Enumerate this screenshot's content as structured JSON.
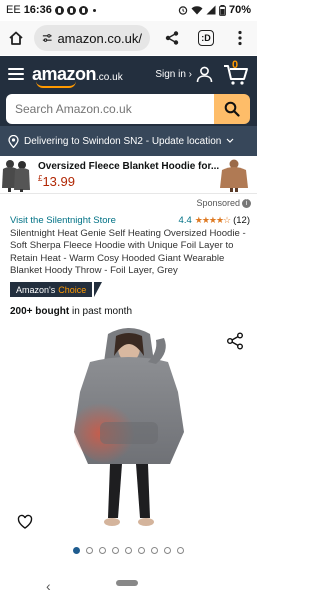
{
  "status_bar": {
    "carrier": "EE",
    "time": "16:36",
    "battery": "70%"
  },
  "browser": {
    "url": "amazon.co.uk/",
    "tab_count": ":D"
  },
  "header": {
    "logo": "amazon",
    "logo_tld": ".co.uk",
    "sign_in": "Sign in ›",
    "cart_count": "0",
    "search_placeholder": "Search Amazon.co.uk",
    "delivery_text": "Delivering to Swindon SN2 - Update location"
  },
  "sponsored_banner": {
    "title": "Oversized Fleece Blanket Hoodie for...",
    "price_symbol": "£",
    "price": "13.99"
  },
  "product": {
    "sponsored_label": "Sponsored",
    "store_link": "Visit the Silentnight Store",
    "rating_value": "4.4",
    "rating_count": "(12)",
    "title": "Silentnight Heat Genie Self Heating Oversized Hoodie - Soft Sherpa Fleece Hoodie with Unique Foil Layer to Retain Heat - Warm Cosy Hooded Giant Wearable Blanket Hoody Throw - Foil Layer, Grey",
    "badge_prefix": "Amazon's",
    "badge_choice": "Choice",
    "bought_bold": "200+ bought",
    "bought_rest": " in past month",
    "image_count": 9,
    "active_image": 0
  },
  "colors": {
    "header_bg": "#232f3e",
    "delivery_bg": "#37475a",
    "accent": "#ff9900",
    "search_button": "#febd69",
    "price": "#b12704",
    "link": "#007185",
    "star": "#de7921"
  }
}
